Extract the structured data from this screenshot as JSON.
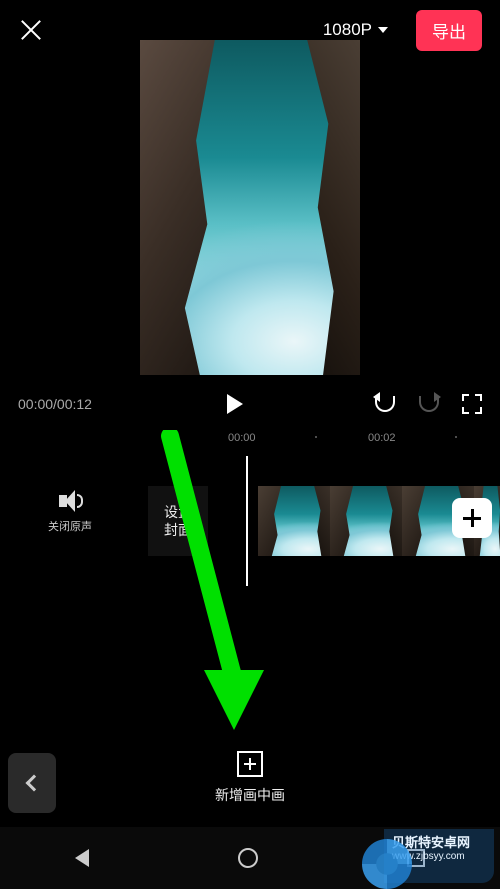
{
  "header": {
    "resolution_label": "1080P",
    "export_label": "导出"
  },
  "controls": {
    "timecode": "00:00/00:12"
  },
  "ruler": {
    "mark_0": "00:00",
    "mark_2": "00:02"
  },
  "track": {
    "mute_label": "关闭原声",
    "cover_label": "设置\n封面"
  },
  "bottom": {
    "pip_label": "新增画中画"
  },
  "watermark": {
    "name": "贝斯特安卓网",
    "url": "www.zjbsyy.com"
  }
}
